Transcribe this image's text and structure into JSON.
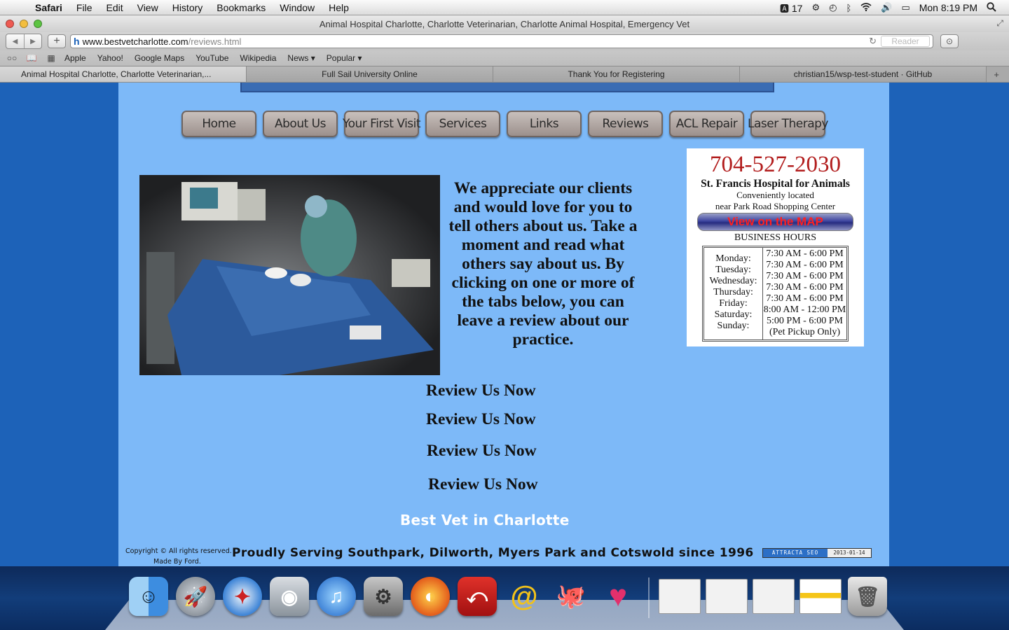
{
  "menubar": {
    "app_name": "Safari",
    "menus": [
      "File",
      "Edit",
      "View",
      "History",
      "Bookmarks",
      "Window",
      "Help"
    ],
    "status": {
      "adobe_count": "17",
      "clock": "Mon 8:19 PM"
    }
  },
  "window": {
    "title": "Animal Hospital Charlotte, Charlotte Veterinarian, Charlotte Animal Hospital, Emergency Vet",
    "url_host": "www.bestvetcharlotte.com",
    "url_path": "/reviews.html",
    "reader_label": "Reader",
    "bookmarks": [
      "Apple",
      "Yahoo!",
      "Google Maps",
      "YouTube",
      "Wikipedia",
      "News ▾",
      "Popular ▾"
    ],
    "tabs": [
      "Animal Hospital Charlotte, Charlotte Veterinarian,...",
      "Full Sail University Online",
      "Thank You for Registering",
      "christian15/wsp-test-student · GitHub"
    ]
  },
  "page": {
    "nav": [
      "Home",
      "About Us",
      "Your First Visit",
      "Services",
      "Links",
      "Reviews",
      "ACL Repair",
      "Laser Therapy"
    ],
    "intro": "We appreciate our clients and would love for you to tell others about us. Take a moment and read what others say about us. By clicking on one or more of the tabs below, you can leave a review about our practice.",
    "review_links": [
      "Review Us Now",
      "Review Us Now",
      "Review Us Now",
      "Review Us Now"
    ],
    "infobox": {
      "phone": "704-527-2030",
      "hospital_name": "St. Francis Hospital for Animals",
      "location_line1": "Conveniently located",
      "location_line2": "near Park Road Shopping Center",
      "map_button": "View on the MAP",
      "hours_heading": "BUSINESS HOURS",
      "days": [
        "Monday:",
        "Tuesday:",
        "Wednesday:",
        "Thursday:",
        "Friday:",
        "Saturday:",
        "Sunday:"
      ],
      "times": [
        "7:30 AM - 6:00 PM",
        "7:30 AM - 6:00 PM",
        "7:30 AM - 6:00 PM",
        "7:30 AM - 6:00 PM",
        "7:30 AM - 6:00 PM",
        "8:00 AM - 12:00 PM",
        "5:00 PM - 6:00 PM",
        "(Pet Pickup Only)"
      ]
    },
    "footer": {
      "best_vet": "Best Vet in Charlotte",
      "copyright": "Copyright © All rights reserved.",
      "made_by": "Made By Ford.",
      "tagline": "Proudly Serving Southpark, Dilworth, Myers Park and Cotswold since 1996",
      "badge_label": "ATTRACTA SEO",
      "badge_date": "2013-01-14"
    }
  },
  "dock": {
    "apps": [
      "finder-icon",
      "launchpad-icon",
      "safari-icon",
      "facetime-icon",
      "itunes-icon",
      "system-preferences-icon",
      "firefox-icon",
      "acrobat-icon",
      "dreamweaver-icon",
      "github-icon",
      "heart-app-icon"
    ],
    "windows": [
      "window-thumbnail",
      "window-thumbnail",
      "window-thumbnail",
      "window-thumbnail"
    ],
    "trash": "trash-icon"
  },
  "colors": {
    "page_background": "#1d62b8",
    "content_background": "#7db9f8",
    "phone_red": "#b21d1d",
    "map_button_text": "#ff2020"
  }
}
